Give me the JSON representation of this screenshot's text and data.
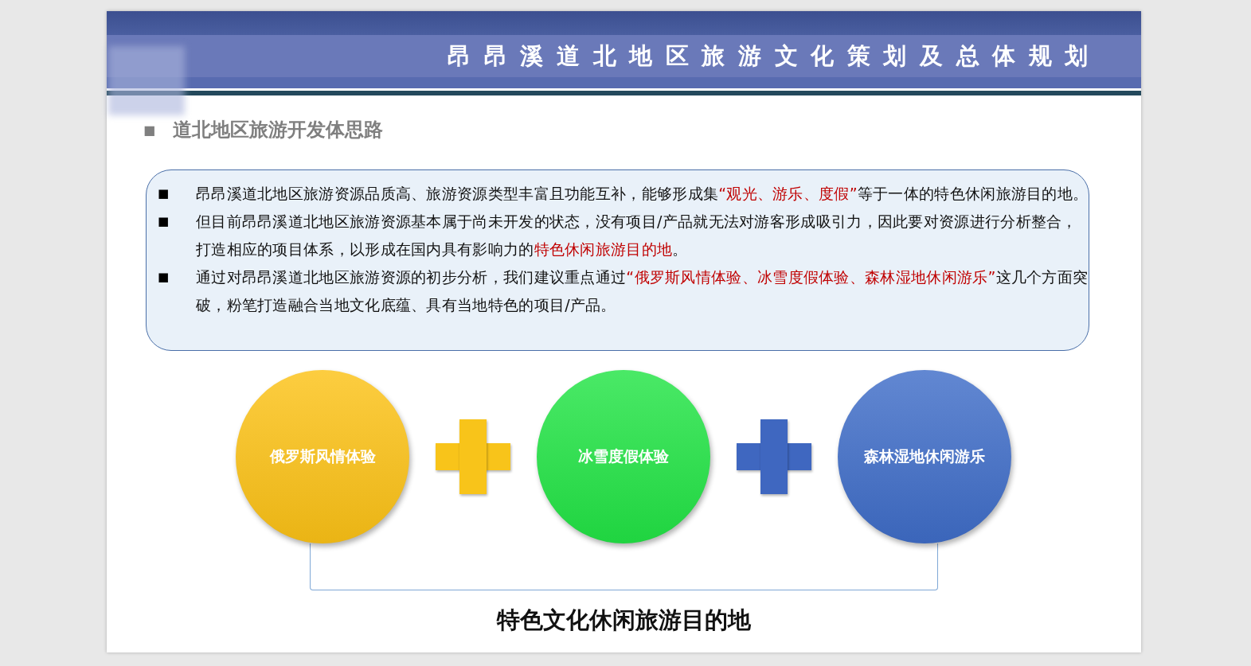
{
  "slide": {
    "title": "昂昂溪道北地区旅游文化策划及总体规划",
    "heading": {
      "marker": "■",
      "text": "道北地区旅游开发体思路"
    },
    "bullets": [
      {
        "marker": "■",
        "parts": [
          {
            "text": "昂昂溪道北地区旅游资源品质高、旅游资源类型丰富且功能互补，能够形成集",
            "highlight": false
          },
          {
            "text": "“观光、游乐、度假”",
            "highlight": true
          },
          {
            "text": "等于一体的特色休闲旅游目的地。",
            "highlight": false
          }
        ]
      },
      {
        "marker": "■",
        "parts": [
          {
            "text": "但目前昂昂溪道北地区旅游资源基本属于尚未开发的状态，没有项目/产品就无法对游客形成吸引力，因此要对资源进行分析整合，打造相应的项目体系，以形成在国内具有影响力的",
            "highlight": false
          },
          {
            "text": "特色休闲旅游目的地",
            "highlight": true
          },
          {
            "text": "。",
            "highlight": false
          }
        ]
      },
      {
        "marker": "■",
        "parts": [
          {
            "text": "通过对昂昂溪道北地区旅游资源的初步分析，我们建议重点通过",
            "highlight": false
          },
          {
            "text": "“俄罗斯风情体验、冰雪度假体验、森林湿地休闲游乐”",
            "highlight": true
          },
          {
            "text": "这几个方面突破，粉笔打造融合当地文化底蕴、具有当地特色的项目/产品。",
            "highlight": false
          }
        ]
      }
    ],
    "themes": [
      {
        "label": "俄罗斯风情体验",
        "color": "#fcc216"
      },
      {
        "label": "冰雪度假体验",
        "color": "#22e445"
      },
      {
        "label": "森林湿地休闲游乐",
        "color": "#3f6dc8"
      }
    ],
    "operators": [
      {
        "color": "#f8c41a"
      },
      {
        "color": "#3f67c0"
      }
    ],
    "conclusion": "特色文化休闲旅游目的地"
  }
}
